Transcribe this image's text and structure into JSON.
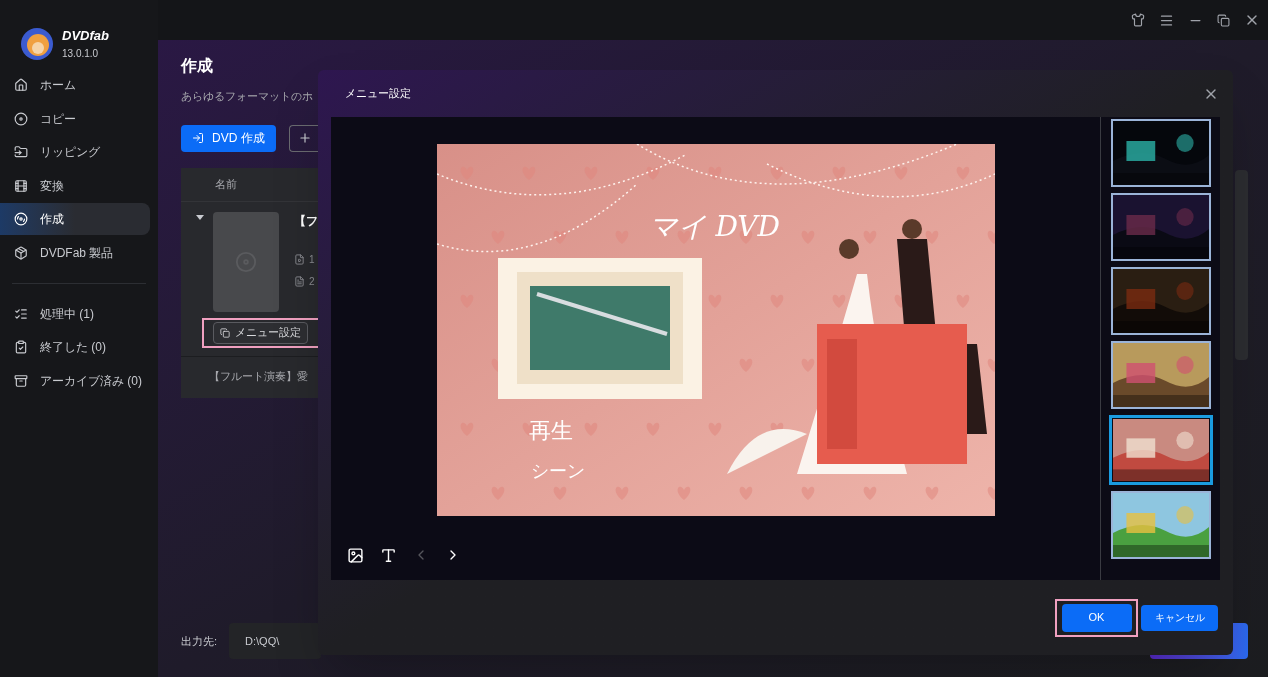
{
  "app": {
    "name": "DVDfab",
    "version": "13.0.1.0"
  },
  "sidebar": {
    "items": [
      {
        "label": "ホーム",
        "selected": false
      },
      {
        "label": "コピー",
        "selected": false
      },
      {
        "label": "リッピング",
        "selected": false
      },
      {
        "label": "変換",
        "selected": false
      },
      {
        "label": "作成",
        "selected": true
      },
      {
        "label": "DVDFab 製品",
        "selected": false
      }
    ],
    "queue": [
      {
        "label": "処理中 (1)",
        "selected": false
      },
      {
        "label": "終了した (0)",
        "selected": false
      },
      {
        "label": "アーカイブ済み (0)",
        "selected": false
      }
    ]
  },
  "main": {
    "title": "作成",
    "subtitle": "あらゆるフォーマットのホ",
    "create_button": "DVD 作成",
    "table": {
      "column": "名前",
      "item": {
        "title": "【フ",
        "meta": [
          "1",
          "2"
        ],
        "menu_button": "メニュー設定"
      },
      "row_2": "【フルート演奏】愛"
    },
    "output": {
      "label": "出力先:",
      "path": "D:\\QQ\\"
    }
  },
  "dialog": {
    "title": "メニュー設定",
    "preview": {
      "title": "マイ DVD",
      "buttons": [
        "再生",
        "シーン"
      ]
    },
    "nav": {
      "prev_disabled": true,
      "next_disabled": false
    },
    "templates": [
      {
        "selected": false
      },
      {
        "selected": false
      },
      {
        "selected": false
      },
      {
        "selected": false
      },
      {
        "selected": true
      },
      {
        "selected": false
      }
    ],
    "ok": "OK",
    "cancel": "キャンセル"
  }
}
